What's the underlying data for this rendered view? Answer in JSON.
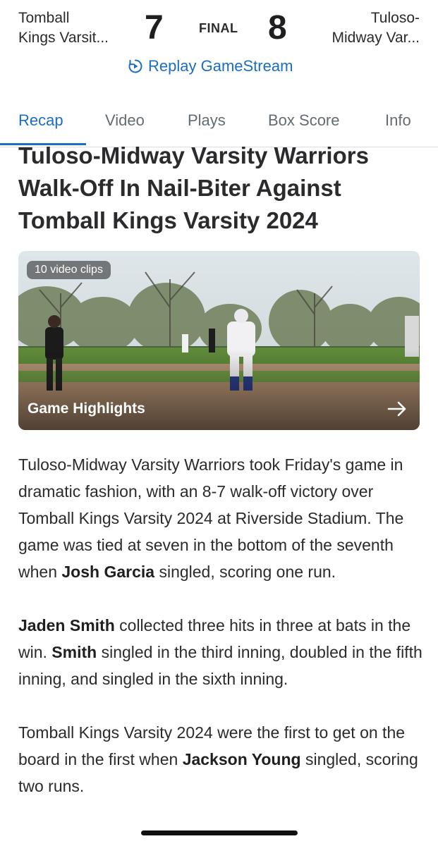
{
  "scoreboard": {
    "away_team": {
      "line1": "Tomball",
      "line2": "Kings Varsit...",
      "score": "7"
    },
    "home_team": {
      "line1": "Tuloso-",
      "line2": "Midway Var...",
      "score": "8"
    },
    "status": "FINAL",
    "replay_label": "Replay GameStream"
  },
  "tabs": [
    {
      "label": "Recap",
      "active": true
    },
    {
      "label": "Video"
    },
    {
      "label": "Plays"
    },
    {
      "label": "Box Score"
    },
    {
      "label": "Info"
    }
  ],
  "article": {
    "headline": "Tuloso-Midway Varsity Warriors Walk-Off In Nail-Biter Against Tomball Kings Varsity 2024",
    "video": {
      "clips_badge": "10 video clips",
      "title": "Game Highlights"
    },
    "paragraphs": [
      {
        "a": "Tuloso-Midway Varsity Warriors took Friday's game in dramatic fashion, with an 8-7 walk-off victory over Tomball Kings Varsity 2024 at Riverside Stadium. The game was tied at seven in the bottom of the seventh when ",
        "b": "Josh Garcia",
        "c": " singled, scoring one run."
      },
      {
        "a": "Jaden Smith",
        "b": " collected three hits in three at bats in the win. ",
        "c": "Smith",
        "d": " singled in the third inning, doubled in the fifth inning, and singled in the sixth inning."
      },
      {
        "a": "Tomball Kings Varsity 2024 were the first to get on the board in the first when ",
        "b": "Jackson Young",
        "c": " singled, scoring two runs."
      }
    ]
  },
  "colors": {
    "accent": "#1a6ec3",
    "text": "#2b2b2e",
    "muted_tab": "#646b73"
  }
}
